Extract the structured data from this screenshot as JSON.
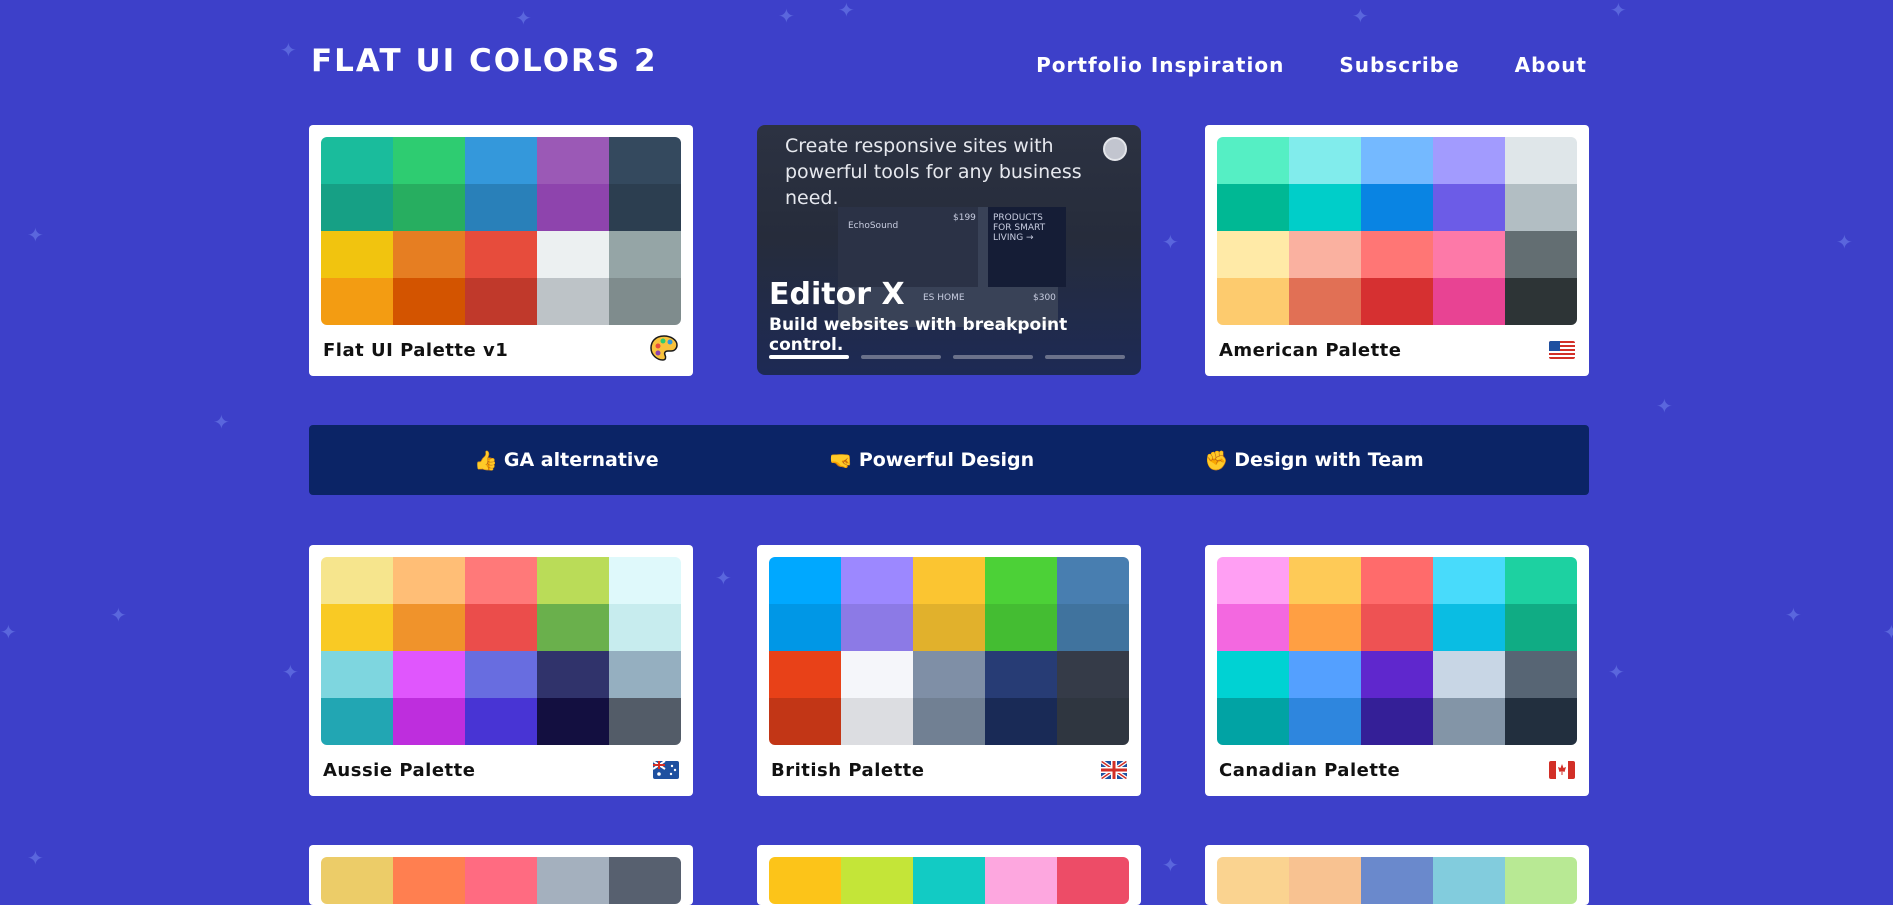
{
  "header": {
    "brand": "FLAT UI COLORS 2",
    "nav": [
      "Portfolio Inspiration",
      "Subscribe",
      "About"
    ]
  },
  "ad": {
    "text": "Create responsive sites with powerful tools for any business need.",
    "mock_labels": [
      "EchoSound",
      "$199",
      "PRODUCTS FOR SMART LIVING →",
      "ES HOME",
      "$300"
    ],
    "title": "Editor X",
    "subtitle": "Build websites with breakpoint control."
  },
  "banner": {
    "items": [
      {
        "emoji": "👍",
        "label": "GA alternative"
      },
      {
        "emoji": "🤜",
        "label": "Powerful Design"
      },
      {
        "emoji": "✊",
        "label": "Design with Team"
      }
    ]
  },
  "palettes": [
    {
      "name": "Flat UI Palette v1",
      "icon": "palette-icon",
      "colors": [
        "#1abc9c",
        "#2ecc71",
        "#3498db",
        "#9b59b6",
        "#34495e",
        "#16a085",
        "#27ae60",
        "#2980b9",
        "#8e44ad",
        "#2c3e50",
        "#f1c40f",
        "#e67e22",
        "#e74c3c",
        "#ecf0f1",
        "#95a5a6",
        "#f39c12",
        "#d35400",
        "#c0392b",
        "#bdc3c7",
        "#7f8c8d"
      ]
    },
    {
      "name": "American Palette",
      "icon": "us-flag-icon",
      "colors": [
        "#55efc4",
        "#81ecec",
        "#74b9ff",
        "#a29bfe",
        "#dfe6e9",
        "#00b894",
        "#00cec9",
        "#0984e3",
        "#6c5ce7",
        "#b2bec3",
        "#ffeaa7",
        "#fab1a0",
        "#ff7675",
        "#fd79a8",
        "#636e72",
        "#fdcb6e",
        "#e17055",
        "#d63031",
        "#e84393",
        "#2d3436"
      ]
    },
    {
      "name": "Aussie Palette",
      "icon": "au-flag-icon",
      "colors": [
        "#f6e58d",
        "#ffbe76",
        "#ff7979",
        "#badc58",
        "#dff9fb",
        "#f9ca24",
        "#f0932b",
        "#eb4d4b",
        "#6ab04c",
        "#c7ecee",
        "#7ed6df",
        "#e056fd",
        "#686de0",
        "#30336b",
        "#95afc0",
        "#22a6b3",
        "#be2edd",
        "#4834d4",
        "#130f40",
        "#535c68"
      ]
    },
    {
      "name": "British Palette",
      "icon": "uk-flag-icon",
      "colors": [
        "#00a8ff",
        "#9c88ff",
        "#fbc531",
        "#4cd137",
        "#487eb0",
        "#0097e6",
        "#8c7ae6",
        "#e1b12c",
        "#44bd32",
        "#40739e",
        "#e84118",
        "#f5f6fa",
        "#7f8fa6",
        "#273c75",
        "#353b48",
        "#c23616",
        "#dcdde1",
        "#718093",
        "#192a56",
        "#2f3640"
      ]
    },
    {
      "name": "Canadian Palette",
      "icon": "ca-flag-icon",
      "colors": [
        "#ff9ff3",
        "#feca57",
        "#ff6b6b",
        "#48dbfb",
        "#1dd1a1",
        "#f368e0",
        "#ff9f43",
        "#ee5253",
        "#0abde3",
        "#10ac84",
        "#00d2d3",
        "#54a0ff",
        "#5f27cd",
        "#c8d6e5",
        "#576574",
        "#01a3a4",
        "#2e86de",
        "#341f97",
        "#8395a7",
        "#222f3e"
      ]
    },
    {
      "name": "",
      "icon": "",
      "colors": [
        "#eccc68",
        "#ff7f50",
        "#ff6b81",
        "#a4b0be",
        "#57606f"
      ]
    },
    {
      "name": "",
      "icon": "",
      "colors": [
        "#fcc419",
        "#c4e538",
        "#12cbc4",
        "#fda7df",
        "#ed4c67"
      ]
    },
    {
      "name": "",
      "icon": "",
      "colors": [
        "#fad390",
        "#f8c291",
        "#6a89cc",
        "#82ccdd",
        "#b8e994"
      ]
    }
  ]
}
